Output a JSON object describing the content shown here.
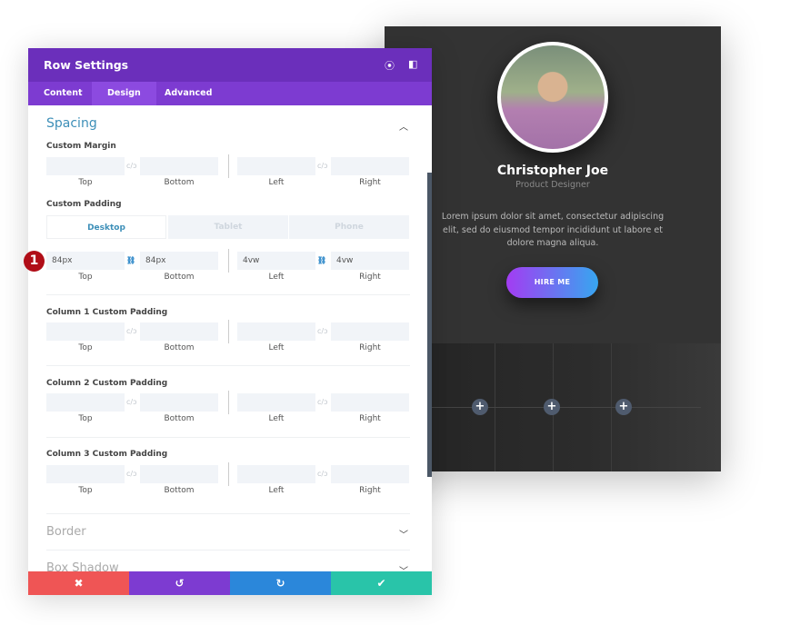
{
  "preview": {
    "name": "Christopher Joe",
    "role": "Product Designer",
    "bio": "Lorem ipsum dolor sit amet, consectetur adipiscing elit, sed do eiusmod tempor incididunt ut labore et dolore magna aliqua.",
    "button": "HIRE ME",
    "add_icon": "+"
  },
  "panel": {
    "title": "Row Settings",
    "tabs": [
      "Content",
      "Design",
      "Advanced"
    ],
    "active_tab": "Design",
    "section": "Spacing",
    "sub_labels": [
      "Top",
      "Bottom",
      "Left",
      "Right"
    ],
    "device_tabs": [
      "Desktop",
      "Tablet",
      "Phone"
    ],
    "groups": [
      {
        "label": "Custom Margin",
        "values": [
          "",
          "",
          "",
          ""
        ]
      },
      {
        "label": "Custom Padding",
        "values": [
          "84px",
          "84px",
          "4vw",
          "4vw"
        ],
        "linked": true
      },
      {
        "label": "Column 1 Custom Padding",
        "values": [
          "",
          "",
          "",
          ""
        ]
      },
      {
        "label": "Column 2 Custom Padding",
        "values": [
          "",
          "",
          "",
          ""
        ]
      },
      {
        "label": "Column 3 Custom Padding",
        "values": [
          "",
          "",
          "",
          ""
        ]
      }
    ],
    "collapsed_sections": [
      "Border",
      "Box Shadow"
    ],
    "annotation": "1"
  },
  "footer": {
    "cancel": "✖",
    "undo": "↺",
    "redo": "↻",
    "save": "✔",
    "colors": {
      "cancel": "#ef5555",
      "undo": "#7d3bd1",
      "redo": "#2b87da",
      "save": "#29c4a9"
    }
  }
}
